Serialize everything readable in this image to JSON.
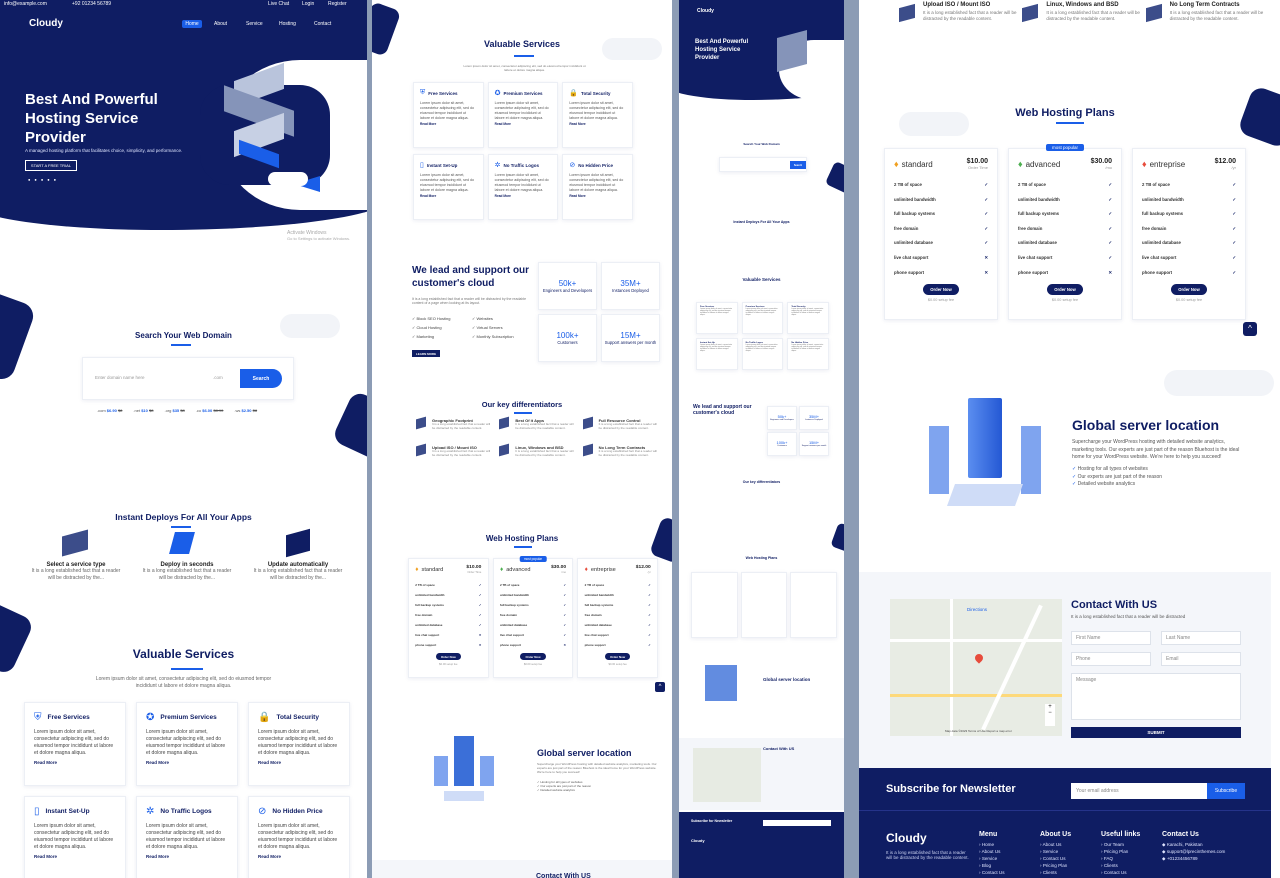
{
  "topbar": {
    "email": "info@example.com",
    "phone": "+92 01234 56789",
    "links": [
      "Live Chat",
      "Login",
      "Register"
    ]
  },
  "brand": "Cloudy",
  "nav": [
    "Home",
    "About",
    "Service",
    "Hosting",
    "Contact"
  ],
  "hero": {
    "title_l1": "Best And Powerful",
    "title_l2": "Hosting Service",
    "title_l3": "Provider",
    "subtitle": "A managed hosting platform that facilitates choice, simplicity, and performance.",
    "cta": "START A FREE TRIAL"
  },
  "watermark": {
    "l1": "Activate Windows",
    "l2": "Go to Settings to activate Windows."
  },
  "domain": {
    "title": "Search Your Web Domain",
    "placeholder": "Enter domain name here",
    "select": ".com",
    "button": "Search",
    "prices": [
      {
        "tld": ".com",
        "new": "$6.90",
        "old": "$8"
      },
      {
        "tld": ".net",
        "new": "$10",
        "old": "$8"
      },
      {
        "tld": ".org",
        "new": "$35",
        "old": "$8"
      },
      {
        "tld": ".co",
        "new": "$6.00",
        "old": "$8.90"
      },
      {
        "tld": ".ws",
        "new": "$2.50",
        "old": "$8"
      }
    ]
  },
  "deploy": {
    "title": "Instant Deploys For All Your Apps",
    "steps": [
      {
        "title": "Select a service type",
        "text": "It is a long established fact that a reader will be distracted by the..."
      },
      {
        "title": "Deploy in seconds",
        "text": "It is a long established fact that a reader will be distracted by the..."
      },
      {
        "title": "Update automatically",
        "text": "It is a long established fact that a reader will be distracted by the..."
      }
    ]
  },
  "services": {
    "title": "Valuable Services",
    "subtitle": "Lorem ipsum dolor sit amet, consectetur adipiscing elit, sed do eiusmod tempor incididunt ut labore et dolore magna aliqua.",
    "body": "Lorem ipsum dolor sit amet, consectetur adipiscing elit, sed do eiusmod tempor incididunt ut labore et dolore magna aliqua.",
    "more": "Read More",
    "items": [
      "Free Services",
      "Premium Services",
      "Total Security",
      "Instant Set-Up",
      "No Traffic Logos",
      "No Hidden Price"
    ]
  },
  "support": {
    "title_l1": "We lead and support our",
    "title_l2": "customer's cloud",
    "text": "It is a long established fact that a reader will be distracted by the readable content of a page when looking at its layout.",
    "list": [
      "Block SEO Hosting",
      "Cloud Hosting",
      "Marketing",
      "Websites",
      "Virtual Servers",
      "Monthly Subscription"
    ],
    "button": "LEARN MORE",
    "stats": [
      {
        "n": "50k+",
        "l": "Engineers and Developers"
      },
      {
        "n": "35M+",
        "l": "Instances Deployed"
      },
      {
        "n": "100k+",
        "l": "Customers"
      },
      {
        "n": "15M+",
        "l": "Support answers per month"
      }
    ]
  },
  "diff": {
    "title": "Our key differentiators",
    "text": "It is a long established fact that a reader will be distracted by the readable content.",
    "items": [
      "Geographic Footprint",
      "Best Of it Apps",
      "Full Resource Control",
      "Upload ISO / Mount ISO",
      "Linux, Windows and BSD",
      "No Long Term Contracts"
    ]
  },
  "plans": {
    "title": "Web Hosting Plans",
    "popular": "most popular",
    "order": "Order Now",
    "items": [
      {
        "name": "standard",
        "price": "$10.00",
        "per": "Order Time",
        "setup": "$0.00 setup fee"
      },
      {
        "name": "advanced",
        "price": "$30.00",
        "per": "/mo",
        "setup": "$0.00 setup fee"
      },
      {
        "name": "entreprise",
        "price": "$12.00",
        "per": "/yr",
        "setup": "$0.00 setup fee"
      }
    ],
    "features": [
      "2 TB of space",
      "unlimited bandwidth",
      "full backup systems",
      "free domain",
      "unlimited database",
      "live chat support",
      "phone support"
    ]
  },
  "global": {
    "title": "Global server location",
    "text": "Supercharge your WordPress hosting with detailed website analytics, marketing tools. Our experts are just part of the reason Bluehost is the ideal home for your WordPress website. We're here to help you succeed!",
    "list": [
      "Hosting for all types of websites",
      "Our experts are just part of the reason",
      "Detailed website analytics"
    ]
  },
  "contact": {
    "title": "Contact With US",
    "sub": "It is a long established fact that a reader will be distracted",
    "fields": [
      "First Name",
      "Last Name",
      "Phone",
      "Email",
      "Message"
    ],
    "submit": "SUBMIT",
    "directions": "Directions",
    "mapnote": "Map data ©2023 Terms of Use Report a map error"
  },
  "newsletter": {
    "title": "Subscribe for Newsletter",
    "placeholder": "Your email address",
    "button": "Subscribe"
  },
  "footer": {
    "brand": "Cloudy",
    "text": "It is a long established fact that a reader will be distracted by the readable content.",
    "menu": {
      "title": "Menu",
      "items": [
        "Home",
        "About Us",
        "Service",
        "Blog",
        "Contact Us"
      ]
    },
    "about": {
      "title": "About Us",
      "items": [
        "About Us",
        "Service",
        "Contact Us",
        "Pricing Plan",
        "Clients"
      ]
    },
    "useful": {
      "title": "Useful links",
      "items": [
        "Our Team",
        "Pricing Plan",
        "FAQ",
        "Clients",
        "Contact Us"
      ]
    },
    "contact": {
      "title": "Contact Us",
      "items": [
        "Karachi, Pakistan",
        "support@lprecinthemes.com",
        "+01234456789"
      ]
    }
  }
}
